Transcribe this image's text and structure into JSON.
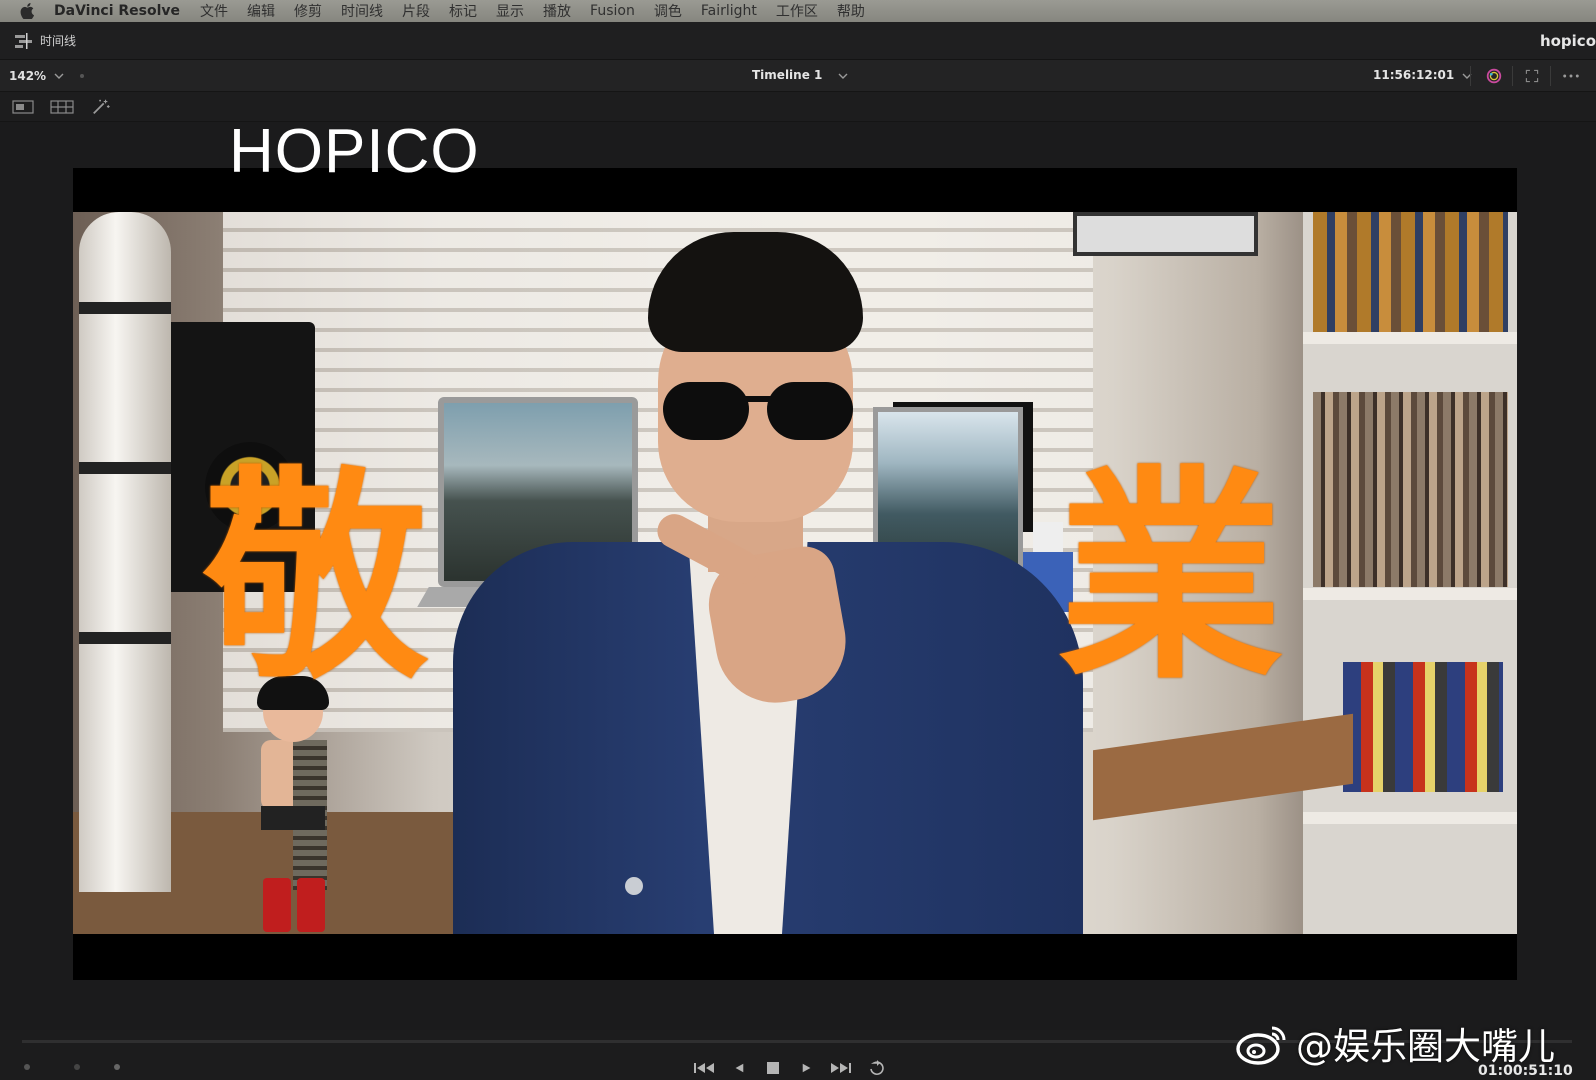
{
  "menubar": {
    "app_name": "DaVinci Resolve",
    "items": [
      "文件",
      "编辑",
      "修剪",
      "时间线",
      "片段",
      "标记",
      "显示",
      "播放",
      "Fusion",
      "调色",
      "Fairlight",
      "工作区",
      "帮助"
    ]
  },
  "titlebar": {
    "panel_label": "时间线",
    "project_name": "hopico"
  },
  "viewer": {
    "zoom": "142%",
    "timeline_name": "Timeline 1",
    "source_timecode": "11:56:12:01",
    "overlay_title": "HOPICO",
    "overlay_left_char": "敬",
    "overlay_right_char": "業",
    "overlay_color": "#ff8a12"
  },
  "transport": {
    "timecode": "01:00:51:10"
  },
  "watermark": {
    "text": "@娱乐圈大嘴儿",
    "icon": "weibo-logo-icon"
  },
  "colors": {
    "ui_background": "#1b1b1c",
    "panel_header": "#232324",
    "menubar": "#8f8f88"
  }
}
